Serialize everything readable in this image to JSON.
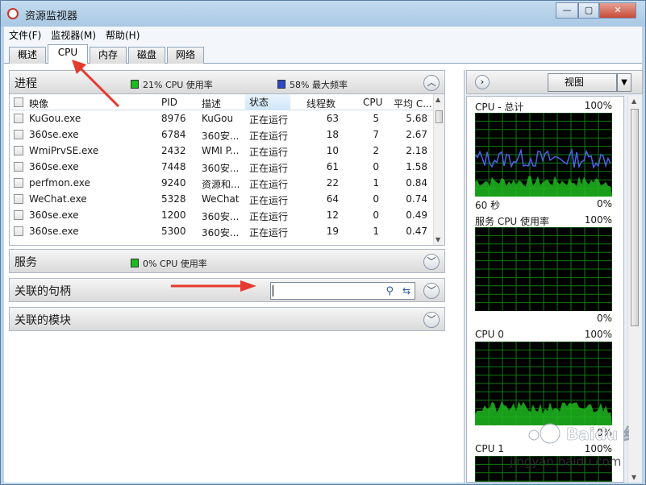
{
  "window": {
    "title": "资源监视器"
  },
  "menu": {
    "items": [
      "文件(F)",
      "监视器(M)",
      "帮助(H)"
    ]
  },
  "tabs": [
    "概述",
    "CPU",
    "内存",
    "磁盘",
    "网络"
  ],
  "active_tab": "CPU",
  "processes": {
    "title": "进程",
    "cpu_usage": "21% CPU 使用率",
    "max_freq": "58% 最大频率",
    "columns": [
      "映像",
      "PID",
      "描述",
      "状态",
      "线程数",
      "CPU",
      "平均 C..."
    ],
    "rows": [
      {
        "image": "KuGou.exe",
        "pid": "8976",
        "desc": "KuGou",
        "status": "正在运行",
        "threads": "63",
        "cpu": "5",
        "avg": "5.68"
      },
      {
        "image": "360se.exe",
        "pid": "6784",
        "desc": "360安...",
        "status": "正在运行",
        "threads": "18",
        "cpu": "7",
        "avg": "2.67"
      },
      {
        "image": "WmiPrvSE.exe",
        "pid": "2432",
        "desc": "WMI P...",
        "status": "正在运行",
        "threads": "10",
        "cpu": "2",
        "avg": "2.18"
      },
      {
        "image": "360se.exe",
        "pid": "7448",
        "desc": "360安...",
        "status": "正在运行",
        "threads": "61",
        "cpu": "0",
        "avg": "1.58"
      },
      {
        "image": "perfmon.exe",
        "pid": "9240",
        "desc": "资源和...",
        "status": "正在运行",
        "threads": "22",
        "cpu": "1",
        "avg": "0.84"
      },
      {
        "image": "WeChat.exe",
        "pid": "5328",
        "desc": "WeChat",
        "status": "正在运行",
        "threads": "64",
        "cpu": "0",
        "avg": "0.74"
      },
      {
        "image": "360se.exe",
        "pid": "1200",
        "desc": "360安...",
        "status": "正在运行",
        "threads": "12",
        "cpu": "0",
        "avg": "0.49"
      },
      {
        "image": "360se.exe",
        "pid": "5300",
        "desc": "360安...",
        "status": "正在运行",
        "threads": "19",
        "cpu": "1",
        "avg": "0.47"
      }
    ]
  },
  "services": {
    "title": "服务",
    "cpu_usage": "0% CPU 使用率"
  },
  "handles": {
    "title": "关联的句柄",
    "search_value": ""
  },
  "modules": {
    "title": "关联的模块"
  },
  "right_panel": {
    "view_label": "视图",
    "graphs": [
      {
        "title": "CPU - 总计",
        "max": "100%",
        "left_bottom": "60 秒",
        "min": "0%"
      },
      {
        "title": "服务 CPU 使用率",
        "max": "100%",
        "min": "0%"
      },
      {
        "title": "CPU 0",
        "max": "100%",
        "min": "0%"
      },
      {
        "title": "CPU 1",
        "max": "100%"
      }
    ]
  },
  "watermark": {
    "text": "jingyan.baidu.com",
    "logo": "Baidu 经验"
  },
  "colors": {
    "cpu_green": "#1fb81f",
    "freq_blue": "#2c46c7",
    "graph_grid": "#117a11"
  }
}
